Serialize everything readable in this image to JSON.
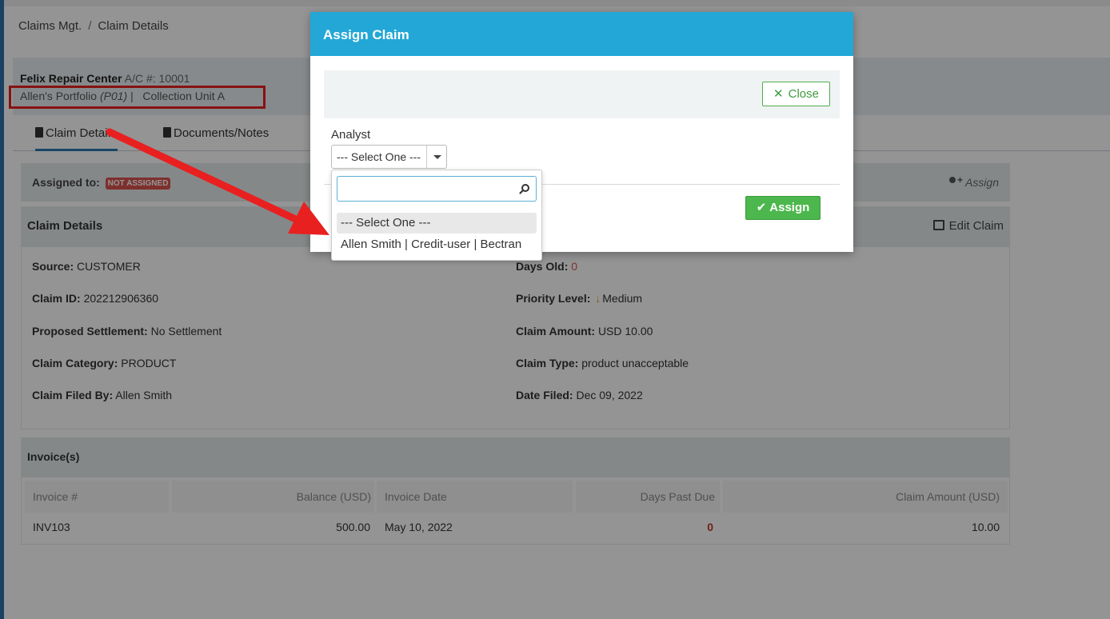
{
  "breadcrumb": {
    "root": "Claims Mgt.",
    "separator": "/",
    "current": "Claim Details"
  },
  "account": {
    "name": "Felix Repair Center",
    "acno_label": "A/C #:",
    "acno": "10001",
    "portfolio": "Allen's Portfolio",
    "portfolio_code": "(P01)",
    "pipe": "|",
    "unit": "Collection Unit A"
  },
  "tabs": [
    {
      "label": "Claim Detai..."
    },
    {
      "label": "Documents/Notes"
    }
  ],
  "assigned": {
    "label": "Assigned to:",
    "badge": "NOT ASSIGNED",
    "assign_link": "Assign"
  },
  "details": {
    "title": "Claim Details",
    "edit_label": "Edit Claim",
    "fields": {
      "source": {
        "label": "Source:",
        "value": "CUSTOMER"
      },
      "claim_id": {
        "label": "Claim ID:",
        "value": "202212906360"
      },
      "proposed": {
        "label": "Proposed Settlement:",
        "value": "No Settlement"
      },
      "category": {
        "label": "Claim Category:",
        "value": "PRODUCT"
      },
      "filed_by": {
        "label": "Claim Filed By:",
        "value": "Allen Smith"
      },
      "days_old": {
        "label": "Days Old:",
        "value": "0"
      },
      "priority": {
        "label": "Priority Level:",
        "value": "Medium"
      },
      "amount": {
        "label": "Claim Amount:",
        "value": "USD 10.00"
      },
      "type": {
        "label": "Claim Type:",
        "value": "product unacceptable"
      },
      "date_filed": {
        "label": "Date Filed:",
        "value": "Dec 09, 2022"
      }
    }
  },
  "invoices": {
    "title": "Invoice(s)",
    "columns": [
      "Invoice #",
      "Balance (USD)",
      "Invoice Date",
      "Days Past Due",
      "Claim Amount (USD)"
    ],
    "rows": [
      {
        "invoice": "INV103",
        "balance": "500.00",
        "date": "May 10, 2022",
        "days_past_due": "0",
        "claim_amount": "10.00"
      }
    ]
  },
  "modal": {
    "title": "Assign Claim",
    "close_label": "Close",
    "analyst_label": "Analyst",
    "select_value": "--- Select One ---",
    "assign_label": "Assign",
    "search_placeholder": "",
    "options": [
      "--- Select One ---",
      "Allen Smith | Credit-user | Bectran"
    ]
  },
  "colors": {
    "modal_header": "#22a7d6",
    "success": "#4cb74c",
    "annotation": "#e82020",
    "badge": "#d9534f"
  }
}
